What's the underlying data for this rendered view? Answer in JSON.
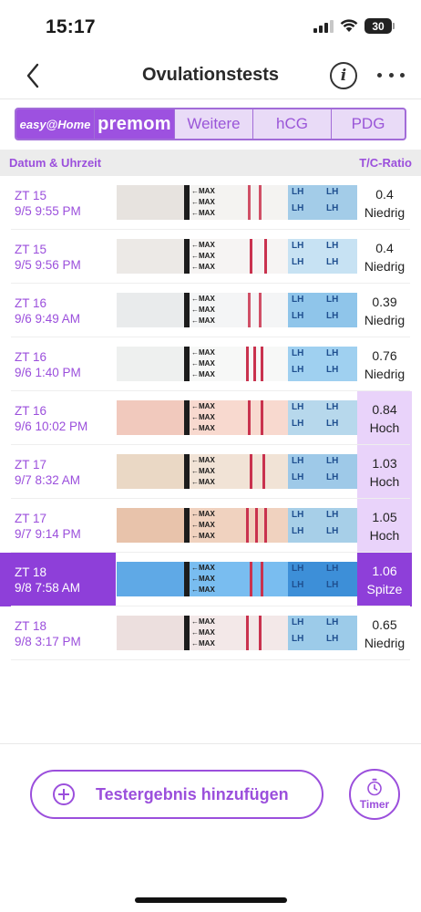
{
  "status_bar": {
    "time": "15:17",
    "battery": "30"
  },
  "nav": {
    "title": "Ovulationstests",
    "info_icon": "info-icon",
    "more_icon": "ellipsis-icon"
  },
  "brand_tabs": [
    {
      "label": "easy@Home",
      "active": true
    },
    {
      "label": "premom",
      "active": true
    },
    {
      "label": "Weitere",
      "active": false
    },
    {
      "label": "hCG",
      "active": false
    },
    {
      "label": "PDG",
      "active": false
    }
  ],
  "table_header": {
    "date": "Datum & Uhrzeit",
    "ratio": "T/C-Ratio"
  },
  "strip_text": {
    "max": "←MAX",
    "lh": "LH"
  },
  "rows": [
    {
      "day": "ZT 15",
      "datetime": "9/5 9:55 PM",
      "ratio": "0.4",
      "level": "Niedrig",
      "state": "normal"
    },
    {
      "day": "ZT 15",
      "datetime": "9/5 9:56 PM",
      "ratio": "0.4",
      "level": "Niedrig",
      "state": "normal"
    },
    {
      "day": "ZT 16",
      "datetime": "9/6 9:49 AM",
      "ratio": "0.39",
      "level": "Niedrig",
      "state": "normal"
    },
    {
      "day": "ZT 16",
      "datetime": "9/6 1:40 PM",
      "ratio": "0.76",
      "level": "Niedrig",
      "state": "normal"
    },
    {
      "day": "ZT 16",
      "datetime": "9/6 10:02 PM",
      "ratio": "0.84",
      "level": "Hoch",
      "state": "hoch"
    },
    {
      "day": "ZT 17",
      "datetime": "9/7 8:32 AM",
      "ratio": "1.03",
      "level": "Hoch",
      "state": "hoch"
    },
    {
      "day": "ZT 17",
      "datetime": "9/7 9:14 PM",
      "ratio": "1.05",
      "level": "Hoch",
      "state": "hoch"
    },
    {
      "day": "ZT 18",
      "datetime": "9/8 7:58 AM",
      "ratio": "1.06",
      "level": "Spitze",
      "state": "selected"
    },
    {
      "day": "ZT 18",
      "datetime": "9/8 3:17 PM",
      "ratio": "0.65",
      "level": "Niedrig",
      "state": "normal"
    }
  ],
  "actions": {
    "add_label": "Testergebnis hinzufügen",
    "timer_label": "Timer"
  },
  "colors": {
    "accent": "#9b4fdc",
    "selected": "#8e3fd9",
    "hoch_bg": "#e9d3fa",
    "test_line": "#c9324e"
  }
}
